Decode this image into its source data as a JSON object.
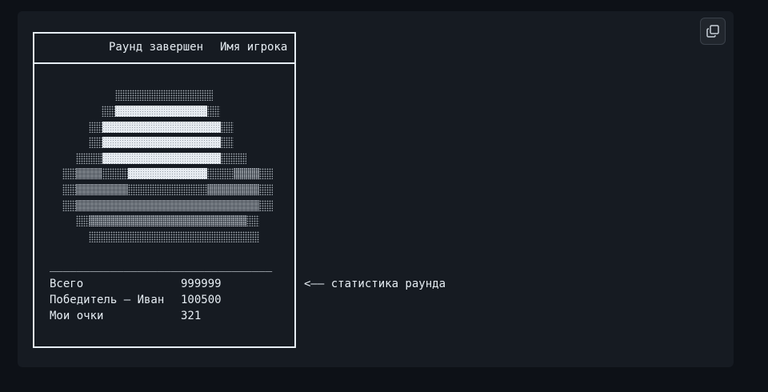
{
  "header": {
    "title": "Раунд завершен",
    "player_label": "Имя игрока"
  },
  "divider": "_________________________________",
  "stats": [
    {
      "label": "Всего",
      "value": "999999"
    },
    {
      "label": "Победитель – Иван",
      "value": "100500"
    },
    {
      "label": "Мои очки",
      "value": "321"
    }
  ],
  "annotation": "<—— статистика раунда",
  "toolbar": {
    "copy_icon": "copy-icon"
  },
  "colors": {
    "page_background": "#0d1117",
    "panel_background": "#161b22",
    "foreground": "#e6edf3"
  }
}
